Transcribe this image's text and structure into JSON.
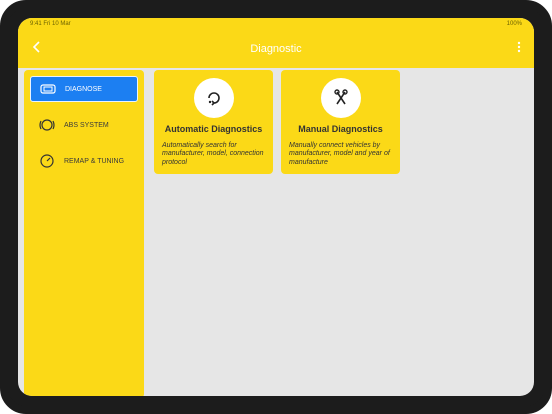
{
  "status": {
    "left": "9:41  Fri 10 Mar",
    "right": "100%"
  },
  "header": {
    "title": "Diagnostic"
  },
  "sidebar": {
    "items": [
      {
        "label": "DIAGNOSE",
        "active": true,
        "icon": "diagnose-icon"
      },
      {
        "label": "ABS SYSTEM",
        "active": false,
        "icon": "abs-icon"
      },
      {
        "label": "REMAP & TUNING",
        "active": false,
        "icon": "gauge-icon"
      }
    ]
  },
  "cards": [
    {
      "title": "Automatic Diagnostics",
      "description": "Automatically search for manufacturer, model, connection protocol",
      "icon": "auto-diagnostics-icon"
    },
    {
      "title": "Manual Diagnostics",
      "description": "Manually connect vehicles by manufacturer, model and year of manufacture",
      "icon": "manual-diagnostics-icon"
    }
  ],
  "colors": {
    "primary_yellow": "#fbd917",
    "active_blue": "#1c7ff2",
    "screen_bg": "#e6e6e6"
  }
}
